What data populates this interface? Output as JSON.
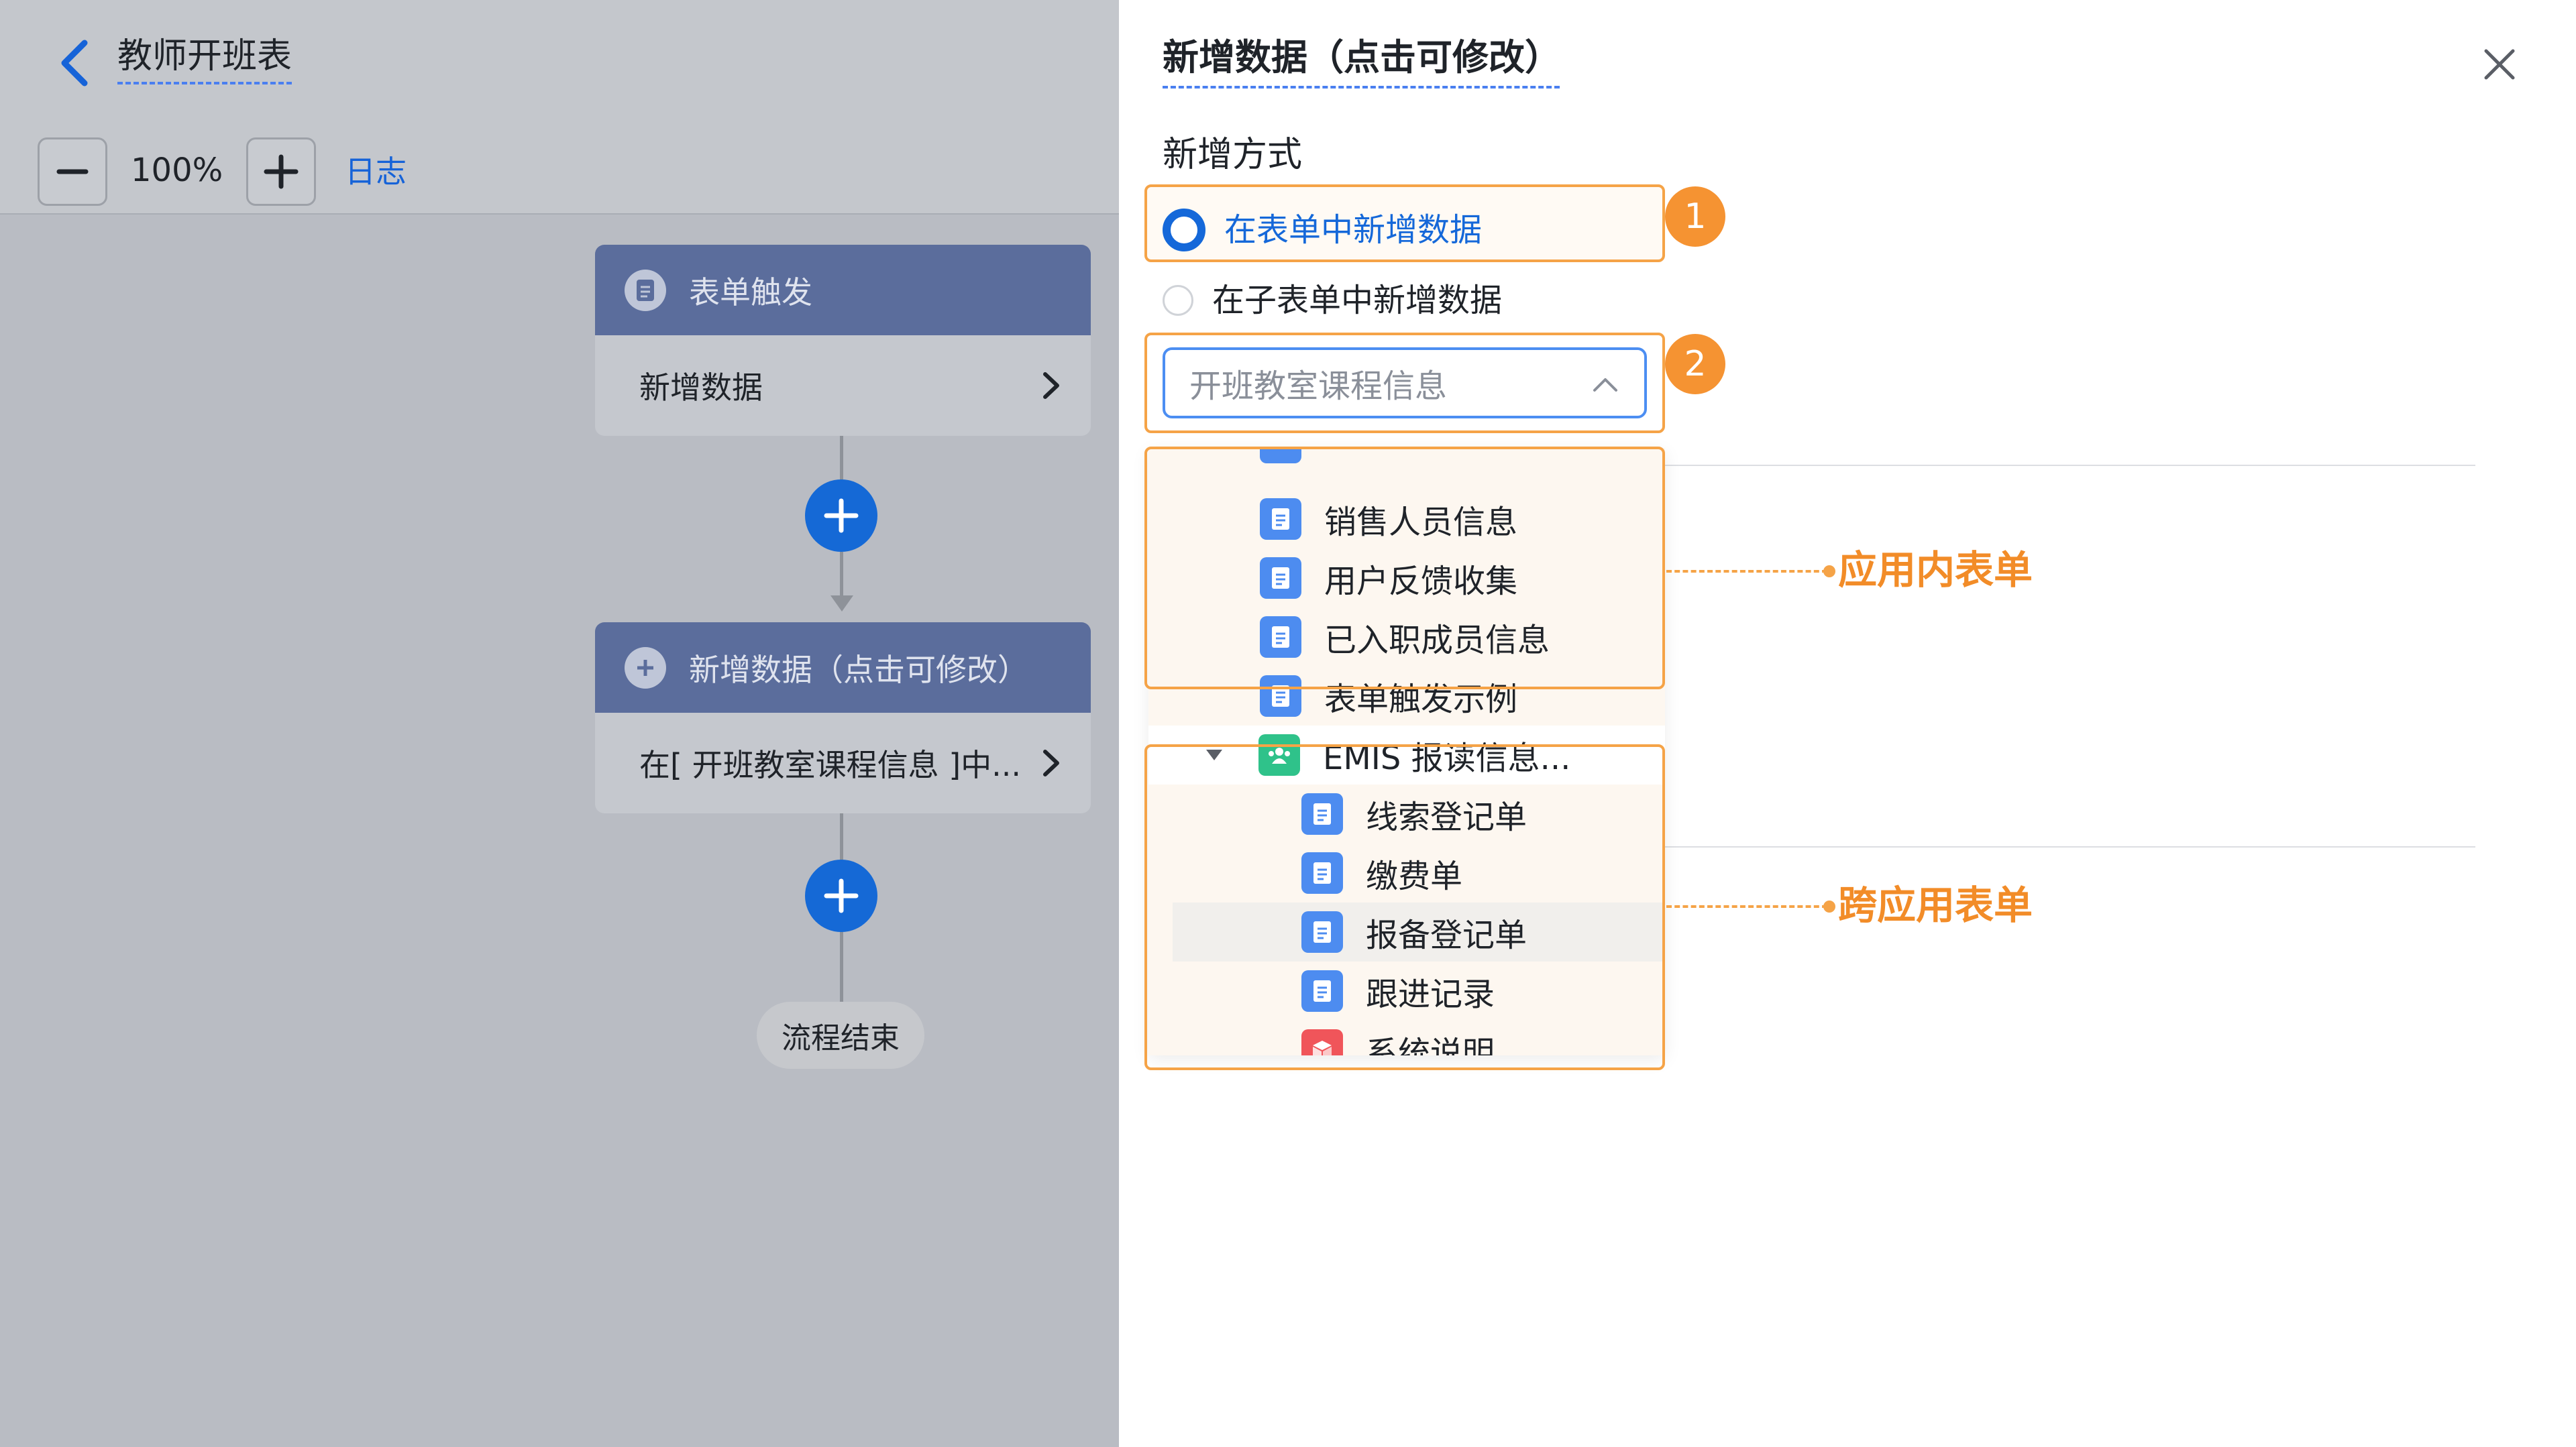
{
  "header": {
    "title": "教师开班表"
  },
  "toolbar": {
    "zoom": "100%",
    "log_label": "日志"
  },
  "flow": {
    "trigger_node": {
      "title": "表单触发",
      "body": "新增数据"
    },
    "action_node": {
      "title": "新增数据（点击可修改）",
      "body": "在[ 开班教室课程信息 ]中..."
    },
    "end_label": "流程结束"
  },
  "panel": {
    "title": "新增数据（点击可修改）",
    "method_label": "新增方式",
    "options": [
      {
        "label": "在表单中新增数据",
        "selected": true
      },
      {
        "label": "在子表单中新增数据",
        "selected": false
      }
    ],
    "select_value": "开班教室课程信息",
    "badges": [
      "1",
      "2"
    ]
  },
  "dropdown": {
    "app_forms": [
      "销售人员信息",
      "用户反馈收集",
      "已入职成员信息",
      "表单触发示例"
    ],
    "group_label": "EMIS 报读信息...",
    "cross_app_forms": [
      "线索登记单",
      "缴费单",
      "报备登记单",
      "跟进记录",
      "系统说明"
    ]
  },
  "annotations": {
    "in_app": "应用内表单",
    "cross_app": "跨应用表单"
  },
  "colors": {
    "accent": "#1568d9",
    "highlight": "#f5a347",
    "badge": "#f59332",
    "annotation_text": "#f28c28",
    "node_header": "#5b6d9c",
    "canvas_overlay": "#b9bcc3"
  }
}
